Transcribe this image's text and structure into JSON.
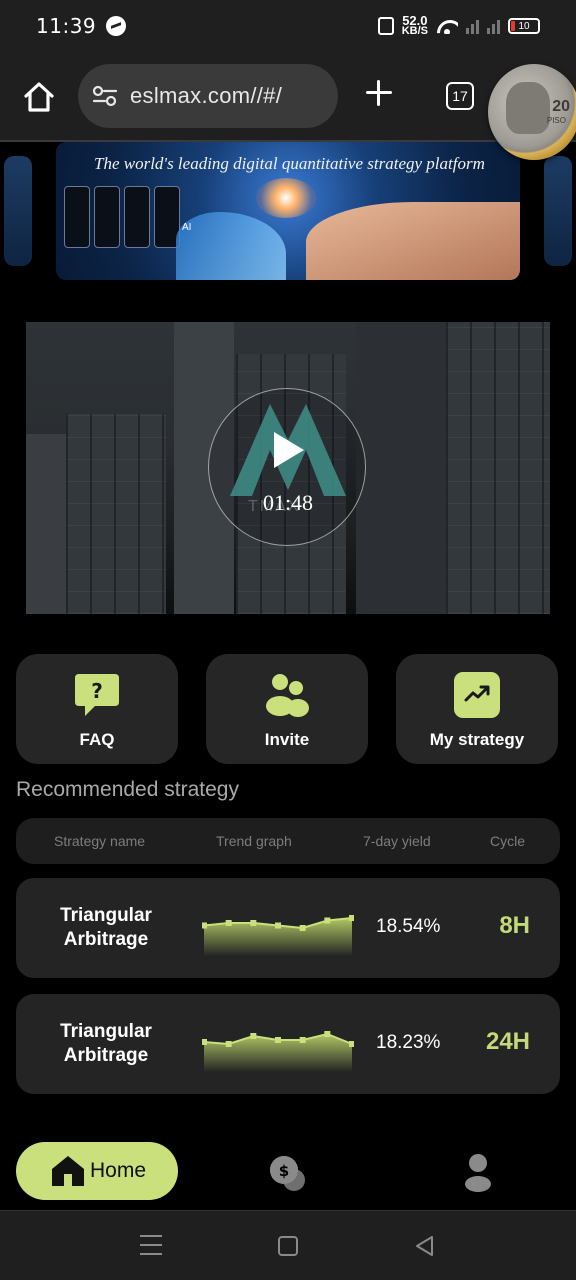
{
  "status_bar": {
    "time": "11:39",
    "net_speed": "52.0",
    "net_unit": "KB/S",
    "battery": "10"
  },
  "browser": {
    "url": "eslmax.com//#/",
    "tab_count": "17"
  },
  "banner": {
    "title": "The world's leading digital quantitative strategy platform",
    "badge": "AI"
  },
  "video": {
    "duration": "01:48"
  },
  "quick_actions": [
    {
      "label": "FAQ",
      "icon": "question-bubble-icon"
    },
    {
      "label": "Invite",
      "icon": "users-icon"
    },
    {
      "label": "My strategy",
      "icon": "trend-chart-icon"
    }
  ],
  "recommended": {
    "title": "Recommended strategy",
    "columns": [
      "Strategy name",
      "Trend graph",
      "7-day yield",
      "Cycle"
    ],
    "rows": [
      {
        "name_line1": "Triangular",
        "name_line2": "Arbitrage",
        "yield": "18.54%",
        "cycle": "8H",
        "trend": [
          6,
          7,
          7,
          6,
          5,
          8,
          9
        ]
      },
      {
        "name_line1": "Triangular",
        "name_line2": "Arbitrage",
        "yield": "18.23%",
        "cycle": "24H",
        "trend": [
          7,
          6,
          10,
          8,
          8,
          11,
          6
        ]
      }
    ]
  },
  "bottom_nav": {
    "home_label": "Home",
    "accent": "#c9e07d"
  },
  "colors": {
    "accent": "#c9e07d",
    "cycle_text": "#c4d97a",
    "card_bg": "#242424"
  }
}
